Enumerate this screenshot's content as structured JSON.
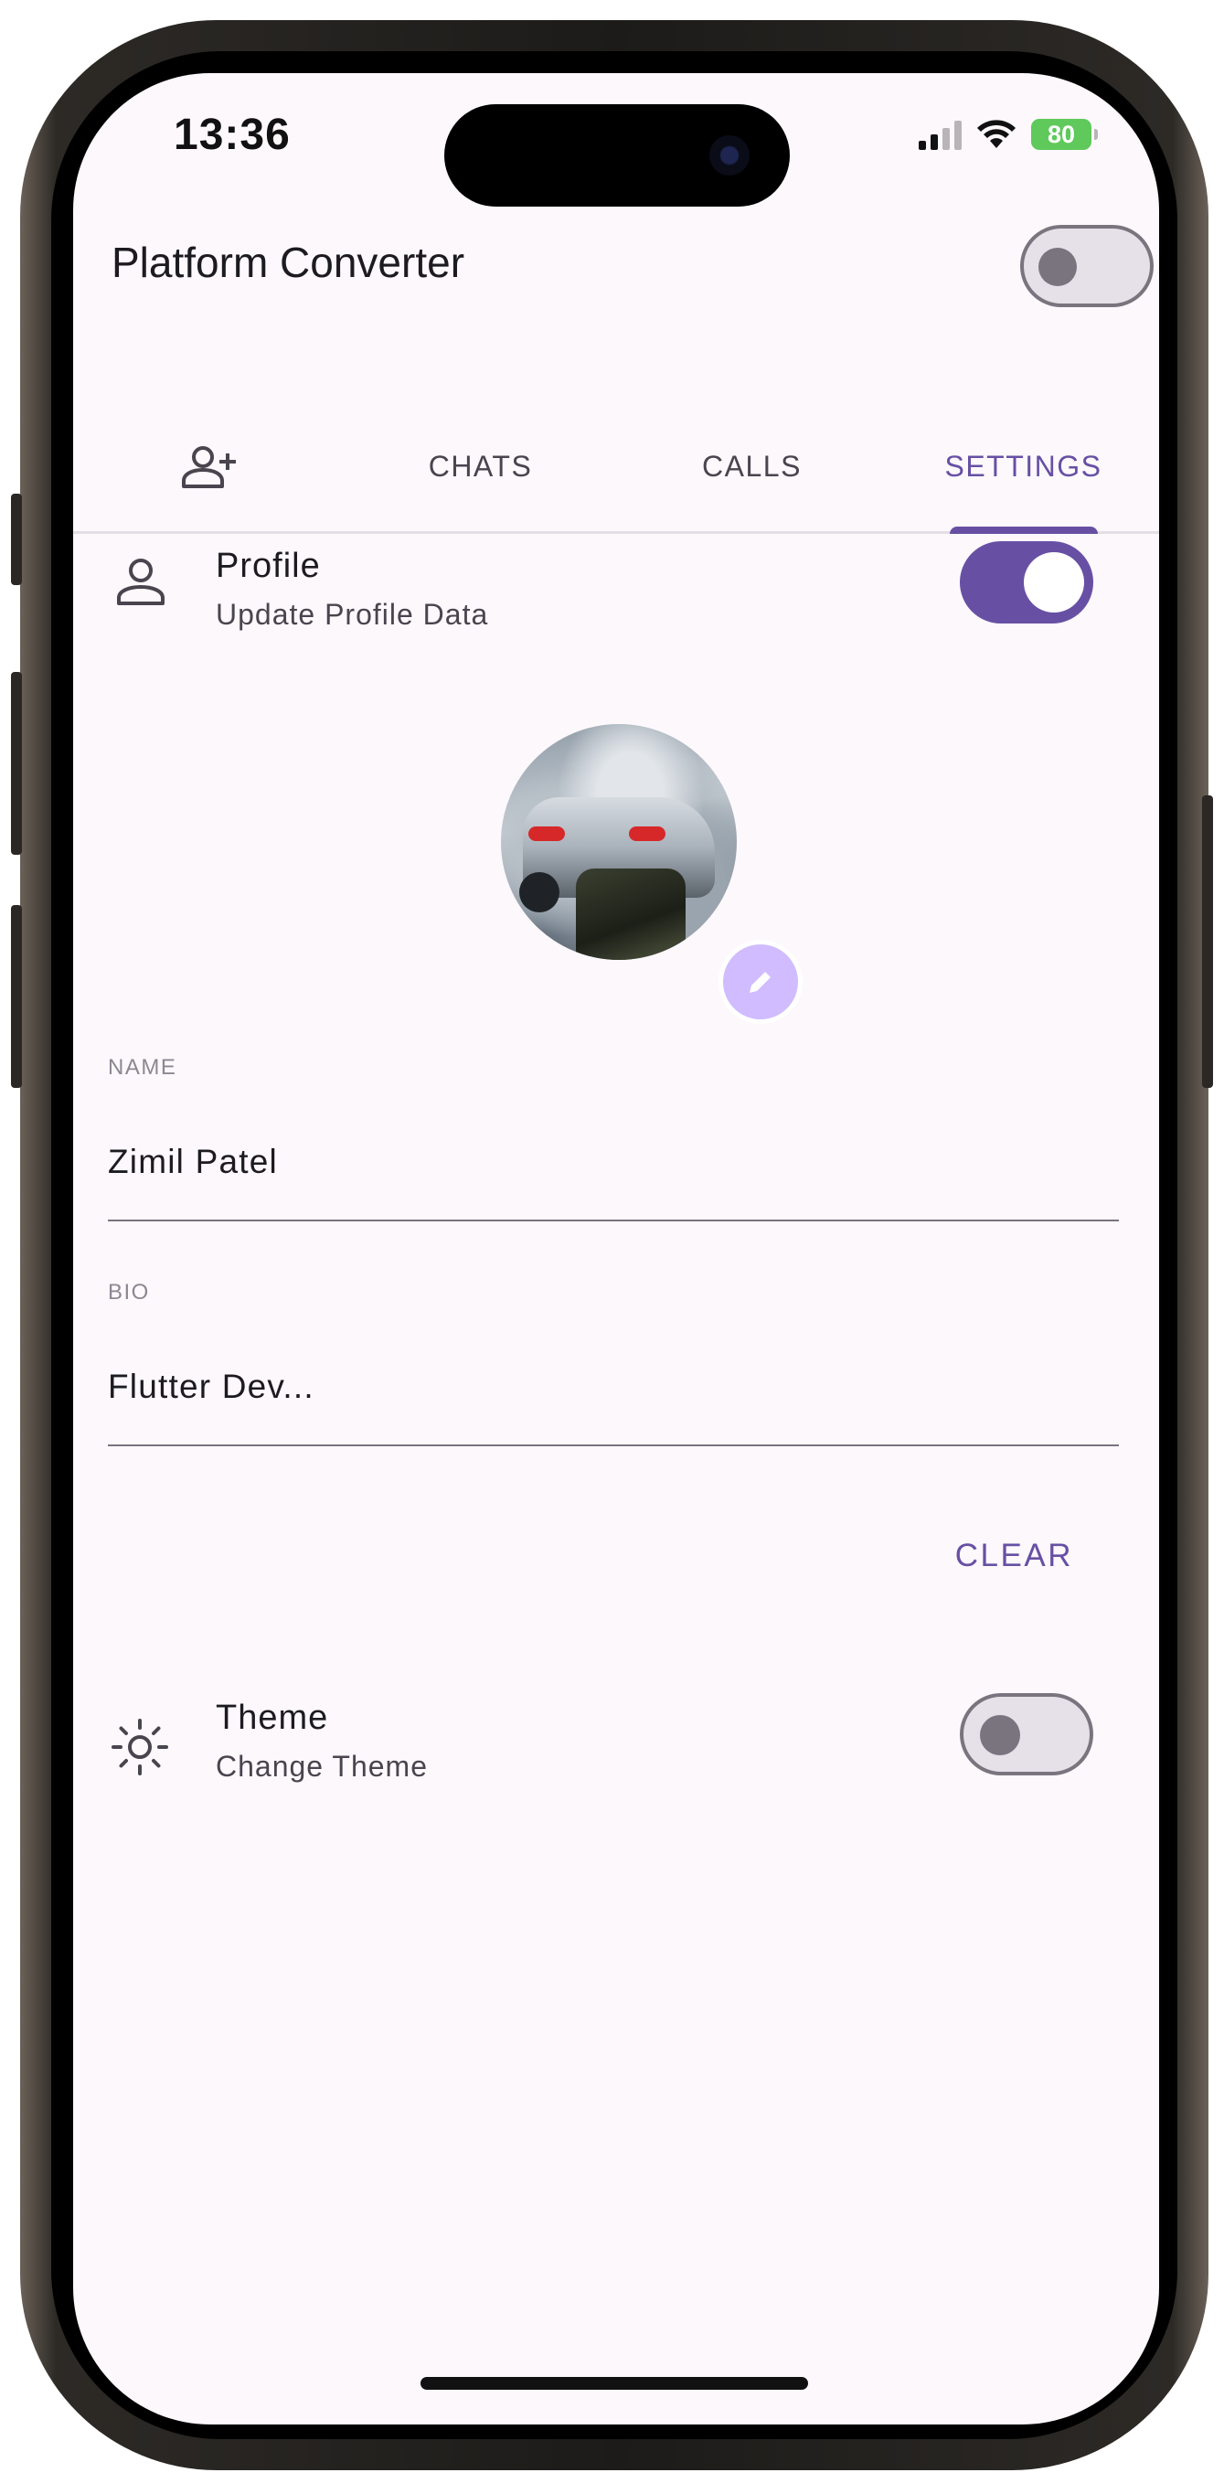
{
  "status_bar": {
    "time": "13:36",
    "battery": "80"
  },
  "app_bar": {
    "title": "Platform Converter",
    "platform_toggle_on": false
  },
  "tabs": [
    {
      "label": "",
      "icon": "add-person-icon",
      "active": false
    },
    {
      "label": "CHATS",
      "active": false
    },
    {
      "label": "CALLS",
      "active": false
    },
    {
      "label": "SETTINGS",
      "active": true
    }
  ],
  "profile_tile": {
    "icon": "person-icon",
    "title": "Profile",
    "subtitle": "Update Profile Data",
    "toggle_on": true
  },
  "avatar": {
    "edit_icon": "pencil-icon"
  },
  "fields": {
    "name": {
      "label": "NAME",
      "value": "Zimil Patel"
    },
    "bio": {
      "label": "BIO",
      "value": "Flutter Dev..."
    }
  },
  "clear_button": {
    "label": "CLEAR"
  },
  "theme_tile": {
    "icon": "sun-icon",
    "title": "Theme",
    "subtitle": "Change Theme",
    "toggle_on": false
  },
  "colors": {
    "primary": "#6750a4",
    "surface": "#fdf8fc",
    "badge": "#d0bcff",
    "battery": "#5fc95b"
  }
}
